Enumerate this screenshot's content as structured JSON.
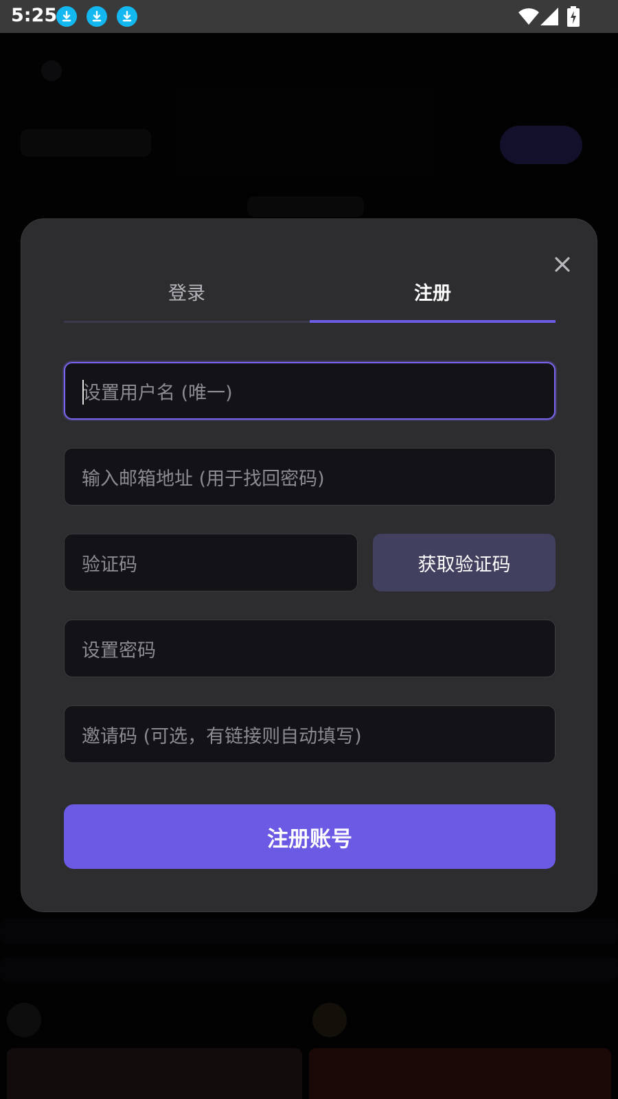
{
  "status_bar": {
    "time": "5:25",
    "notification_icons": [
      "download-icon",
      "download-icon",
      "download-icon"
    ],
    "icons": [
      "wifi-icon",
      "signal-icon",
      "battery-charging-icon"
    ]
  },
  "modal": {
    "close_icon": "close-icon",
    "tabs": [
      {
        "label": "登录",
        "active": false
      },
      {
        "label": "注册",
        "active": true
      }
    ],
    "fields": {
      "username": {
        "placeholder": "设置用户名 (唯一)",
        "value": "",
        "focused": true
      },
      "email": {
        "placeholder": "输入邮箱地址 (用于找回密码)",
        "value": ""
      },
      "code": {
        "placeholder": "验证码",
        "value": ""
      },
      "password": {
        "placeholder": "设置密码",
        "value": ""
      },
      "invite": {
        "placeholder": "邀请码 (可选，有链接则自动填写)",
        "value": ""
      }
    },
    "get_code_label": "获取验证码",
    "submit_label": "注册账号"
  },
  "colors": {
    "accent": "#6b5ae4",
    "modal_bg": "#2d2d30",
    "field_bg": "#131317",
    "secondary_button": "#41405e",
    "status_bar_bg": "#3a3a3a",
    "download_badge": "#13b8f0"
  }
}
